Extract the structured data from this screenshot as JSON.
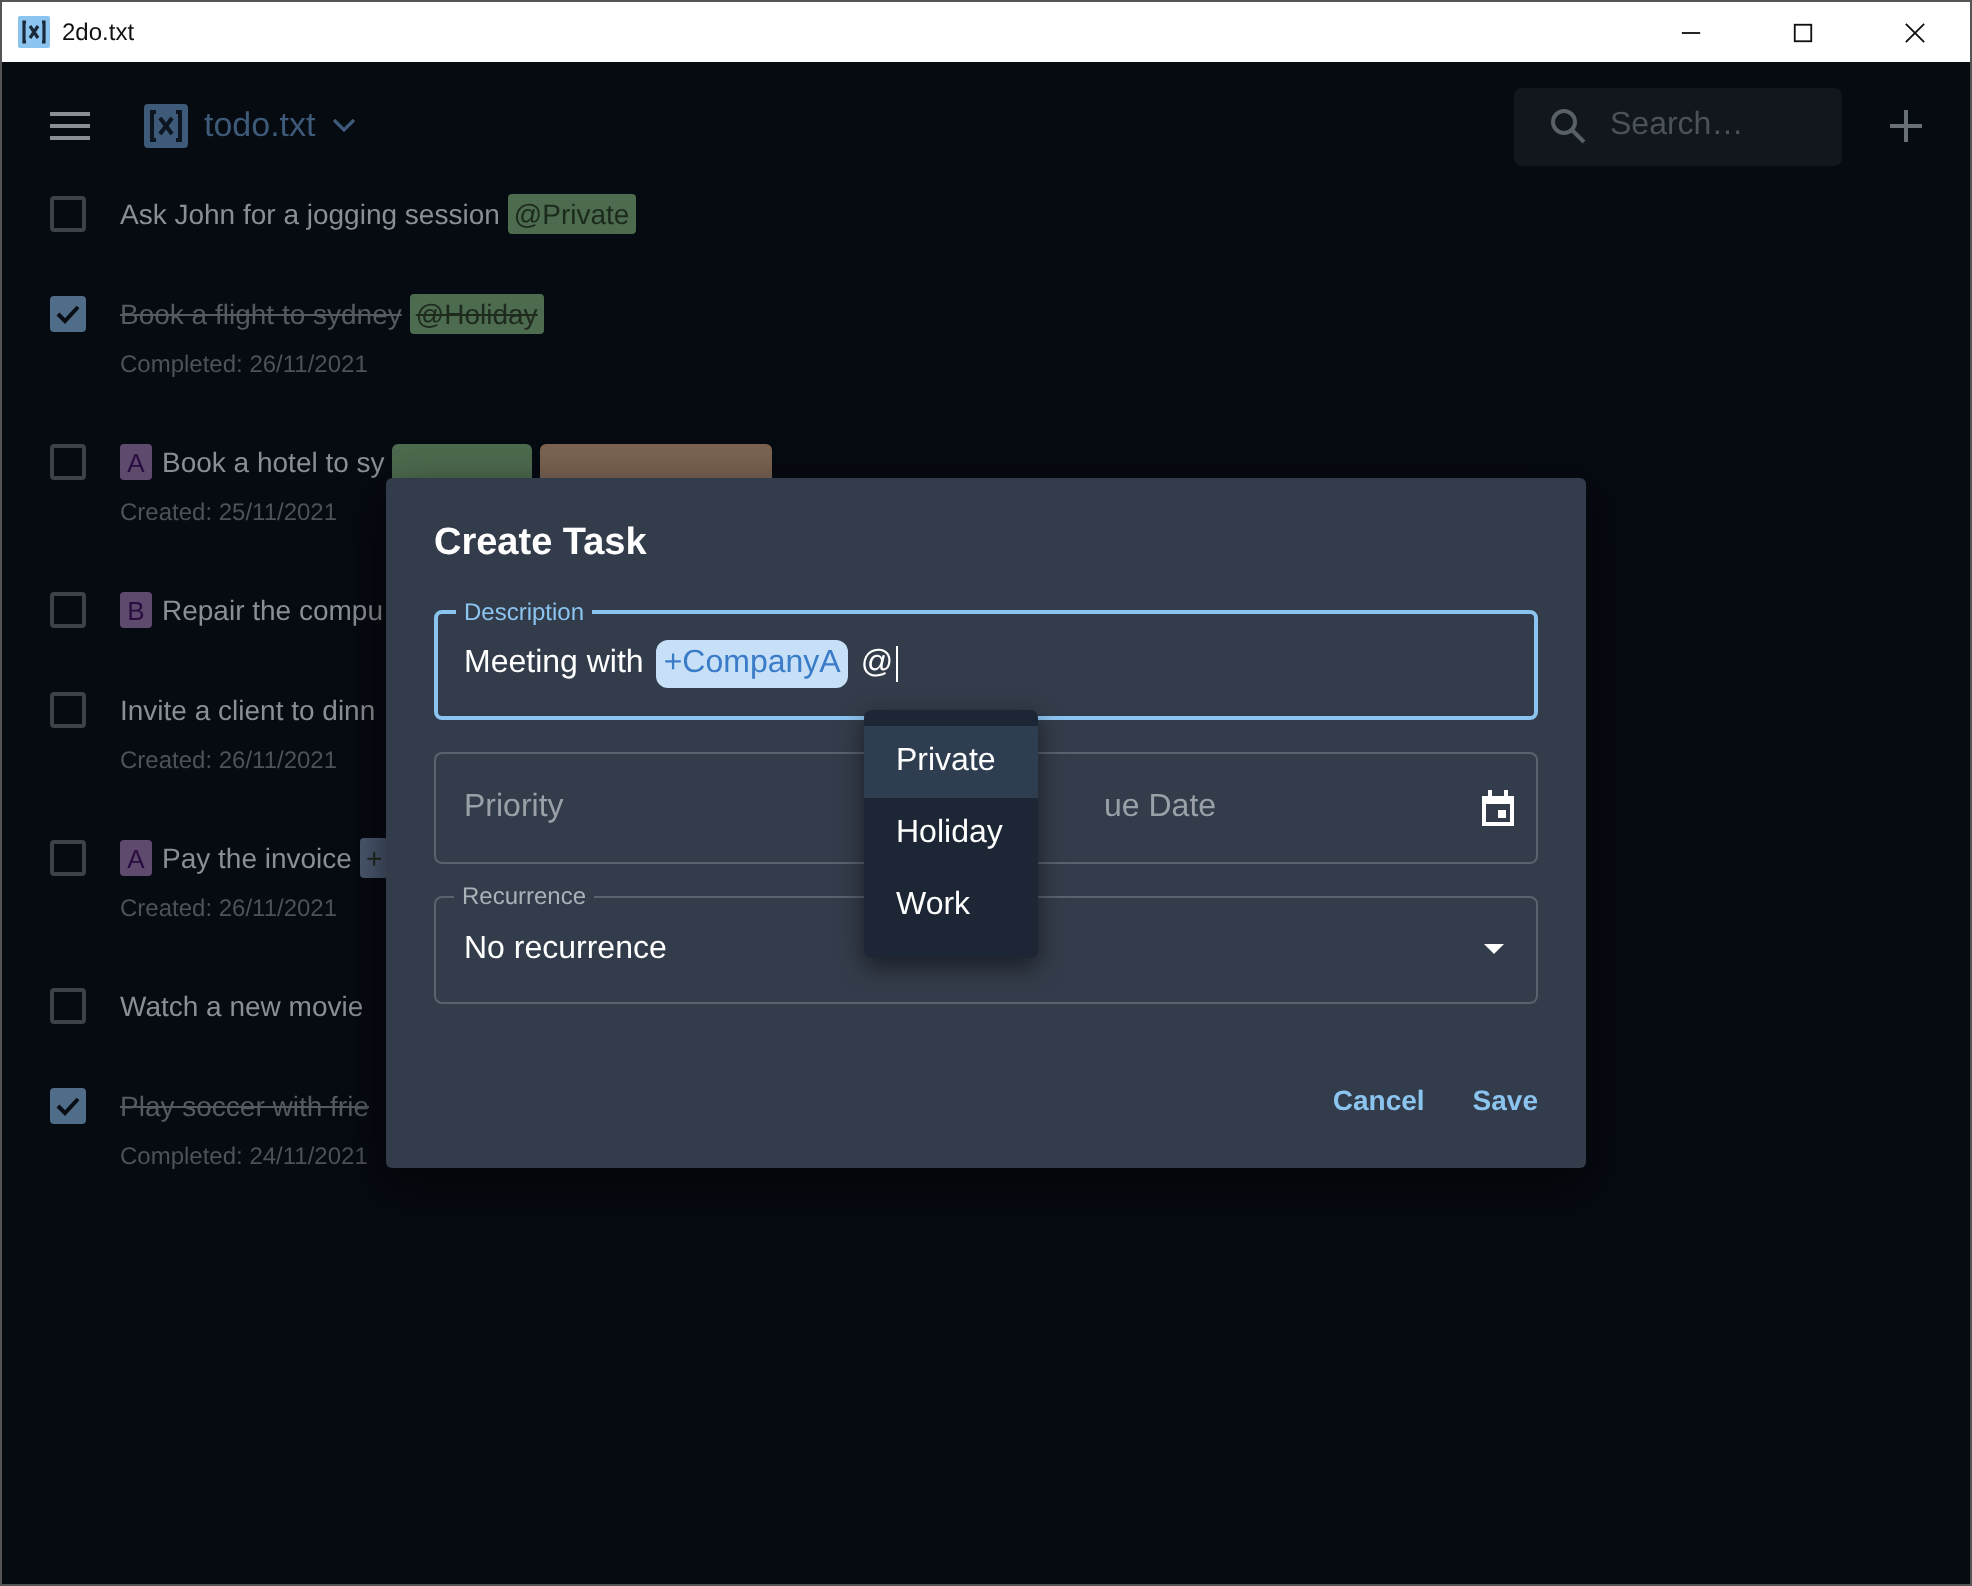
{
  "window": {
    "title": "2do.txt"
  },
  "toolbar": {
    "file": "todo.txt",
    "search": {
      "placeholder": "Search…"
    }
  },
  "tasks": [
    {
      "text": "Ask John for a jogging session",
      "checked": false,
      "tags": [
        {
          "label": "@Private",
          "color": "#4d6b4f"
        }
      ]
    },
    {
      "text": "Book a flight to sydney",
      "checked": true,
      "tags": [
        {
          "label": "@Holiday",
          "color": "#4d6b4f"
        }
      ],
      "meta": "Completed: 26/11/2021"
    },
    {
      "text": "Book a hotel to sy",
      "checked": false,
      "priority": "A",
      "tags": [
        {
          "color": "#4d6b4f"
        },
        {
          "color": "#7a6352"
        }
      ],
      "meta": "Created: 25/11/2021"
    },
    {
      "text": "Repair the compu",
      "checked": false,
      "priority": "B"
    },
    {
      "text": "Invite a client to dinn",
      "checked": false,
      "meta": "Created: 26/11/2021"
    },
    {
      "text": "Pay the invoice",
      "checked": false,
      "priority": "A",
      "tags": [
        {
          "label": "+",
          "color": "#4b5870"
        }
      ],
      "meta": "Created: 26/11/2021"
    },
    {
      "text": "Watch a new movie",
      "checked": false
    },
    {
      "text": "Play soccer with frie",
      "checked": true,
      "meta": "Completed: 24/11/2021"
    }
  ],
  "dialog": {
    "title": "Create Task",
    "description": {
      "label": "Description",
      "text": "Meeting with",
      "project": "+CompanyA",
      "typed": "@"
    },
    "priority": {
      "placeholder": "Priority"
    },
    "due_date": {
      "placeholder": "ue Date"
    },
    "recurrence": {
      "label": "Recurrence",
      "value": "No recurrence"
    },
    "buttons": [
      "Cancel",
      "Save"
    ]
  },
  "suggestions": [
    {
      "label": "Private",
      "selected": true
    },
    {
      "label": "Holiday",
      "selected": false
    },
    {
      "label": "Work",
      "selected": false
    }
  ]
}
